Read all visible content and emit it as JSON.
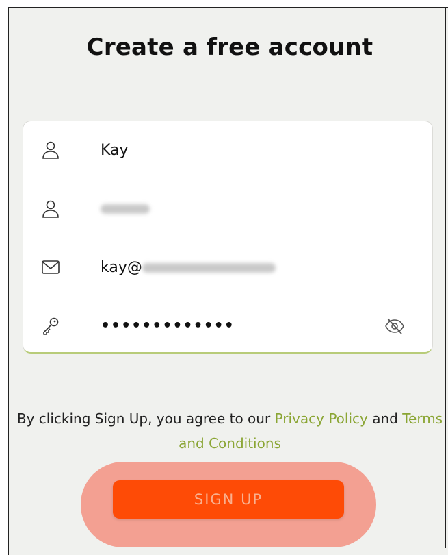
{
  "page": {
    "title": "Create a free account"
  },
  "form": {
    "first_name": {
      "value": "Kay",
      "icon": "user-icon"
    },
    "last_name": {
      "value": "",
      "icon": "user-icon"
    },
    "email": {
      "value_prefix": "kay@",
      "icon": "mail-icon"
    },
    "password": {
      "value": "•••••••••••••",
      "icon": "key-icon",
      "toggle_icon": "eye-off-icon"
    }
  },
  "consent": {
    "prefix": "By clicking Sign Up, you agree to our ",
    "privacy_link": "Privacy Policy",
    "conjunction": " and ",
    "terms_link": "Terms and Conditions"
  },
  "signup": {
    "label": "SIGN UP"
  },
  "colors": {
    "accent_green": "#8aa533",
    "button_orange": "#fe4b06",
    "highlight": "#f3a092"
  }
}
